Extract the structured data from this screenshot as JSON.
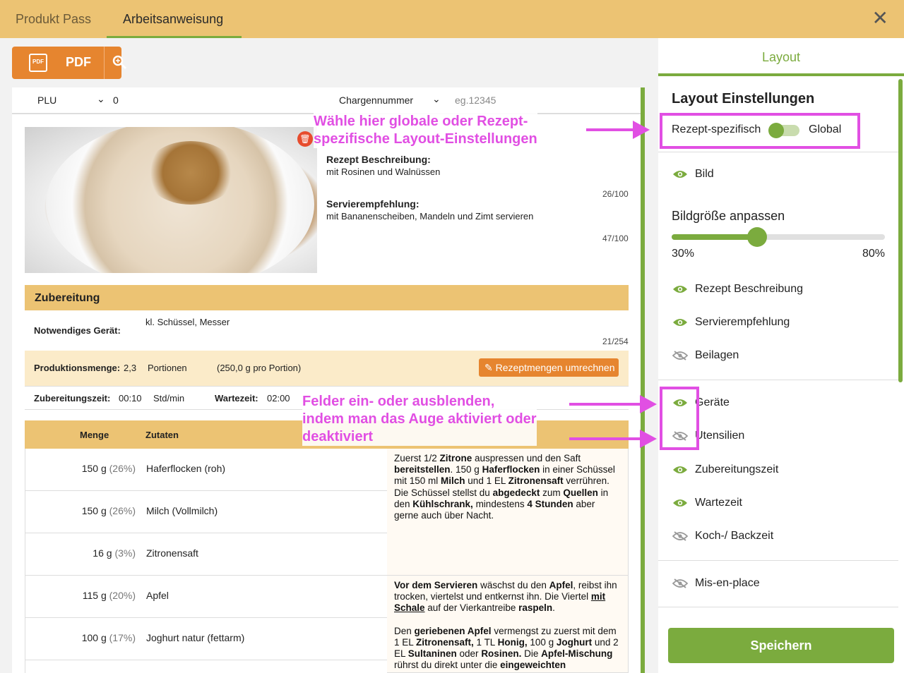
{
  "tabs": {
    "produkt_pass": "Produkt Pass",
    "arbeitsanweisung": "Arbeitsanweisung"
  },
  "toolbar": {
    "pdf_label": "PDF",
    "pdf_icon_text": "PDF"
  },
  "header": {
    "plu_label": "PLU",
    "plu_value": "0",
    "charge_label": "Chargennummer",
    "charge_placeholder": "eg.12345"
  },
  "recipe": {
    "desc_label": "Rezept Beschreibung:",
    "desc_value": "mit Rosinen und Walnüssen",
    "desc_count": "26/100",
    "serv_label": "Servierempfehlung:",
    "serv_value": "mit Bananenscheiben, Mandeln und Zimt servieren",
    "serv_count": "47/100"
  },
  "zubereitung": {
    "title": "Zubereitung",
    "geraet_label": "Notwendiges Gerät:",
    "geraet_value": "kl. Schüssel, Messer",
    "geraet_count": "21/254",
    "prod_label": "Produktionsmenge:",
    "prod_value": "2,3",
    "prod_unit": "Portionen",
    "prod_portion": "(250,0 g pro Portion)",
    "umrechnen_label": "Rezeptmengen umrechnen",
    "zeit_label": "Zubereitungszeit:",
    "zeit_value": "00:10",
    "zeit_unit": "Std/min",
    "warte_label": "Wartezeit:",
    "warte_value": "02:00"
  },
  "table": {
    "col_menge": "Menge",
    "col_zutaten": "Zutaten",
    "rows": [
      {
        "qty": "150 g",
        "pct": "(26%)",
        "name": "Haferflocken (roh)"
      },
      {
        "qty": "150 g",
        "pct": "(26%)",
        "name": "Milch (Vollmilch)"
      },
      {
        "qty": "16 g",
        "pct": "(3%)",
        "name": "Zitronensaft"
      },
      {
        "qty": "115 g",
        "pct": "(20%)",
        "name": "Apfel"
      },
      {
        "qty": "100 g",
        "pct": "(17%)",
        "name": "Joghurt natur (fettarm)"
      }
    ]
  },
  "annotations": {
    "top_line1": "Wähle hier globale oder Rezept-",
    "top_line2": "spezifische Layout-Einstellungen",
    "mid_line1": "Felder ein- oder ausblenden,",
    "mid_line2": "indem man das Auge aktiviert oder",
    "mid_line3": "deaktiviert"
  },
  "sidebar": {
    "tab": "Layout",
    "title": "Layout Einstellungen",
    "toggle_left": "Rezept-spezifisch",
    "toggle_right": "Global",
    "toggle_global": false,
    "bild": "Bild",
    "size_title": "Bildgröße anpassen",
    "size_min": "30%",
    "size_max": "80%",
    "size_level_fraction": 0.4,
    "items": [
      {
        "label": "Rezept Beschreibung",
        "visible": true
      },
      {
        "label": "Servierempfehlung",
        "visible": true
      },
      {
        "label": "Beilagen",
        "visible": false
      },
      {
        "label": "Geräte",
        "visible": true
      },
      {
        "label": "Utensilien",
        "visible": false
      },
      {
        "label": "Zubereitungszeit",
        "visible": true
      },
      {
        "label": "Wartezeit",
        "visible": true
      },
      {
        "label": "Koch-/ Backzeit",
        "visible": false
      },
      {
        "label": "Mis-en-place",
        "visible": false
      }
    ],
    "save": "Speichern"
  },
  "colors": {
    "accent_orange": "#e6852f",
    "accent_green": "#7bab3e",
    "header_gold": "#ecc373",
    "annotation_magenta": "#e14fe3"
  },
  "icons": {
    "close": "close-icon",
    "zoom": "search-icon",
    "pdf": "pdf-icon",
    "delete": "trash-icon",
    "eye": "eye-icon",
    "eye_off": "eye-off-icon",
    "edit": "pencil-icon"
  }
}
